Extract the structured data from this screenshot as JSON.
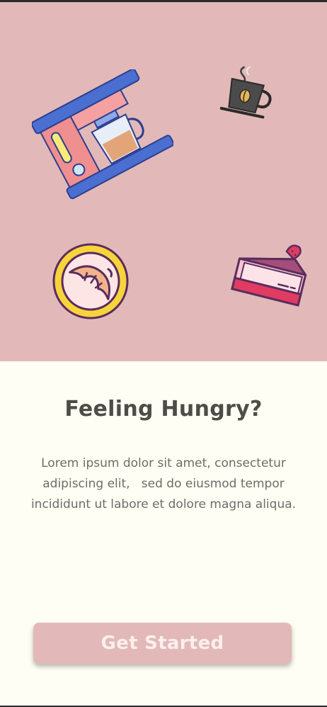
{
  "hero": {
    "background": "#e2b9b8",
    "illustrations": [
      "coffee-machine-icon",
      "coffee-cup-icon",
      "croissant-plate-icon",
      "cake-slice-icon"
    ]
  },
  "onboarding": {
    "title": "Feeling Hungry?",
    "description": "Lorem ipsum dolor sit amet, consectetur adipiscing elit,   sed do eiusmod tempor incididunt ut labore et dolore magna aliqua."
  },
  "cta": {
    "label": "Get Started",
    "color": "#e2b9b8"
  }
}
